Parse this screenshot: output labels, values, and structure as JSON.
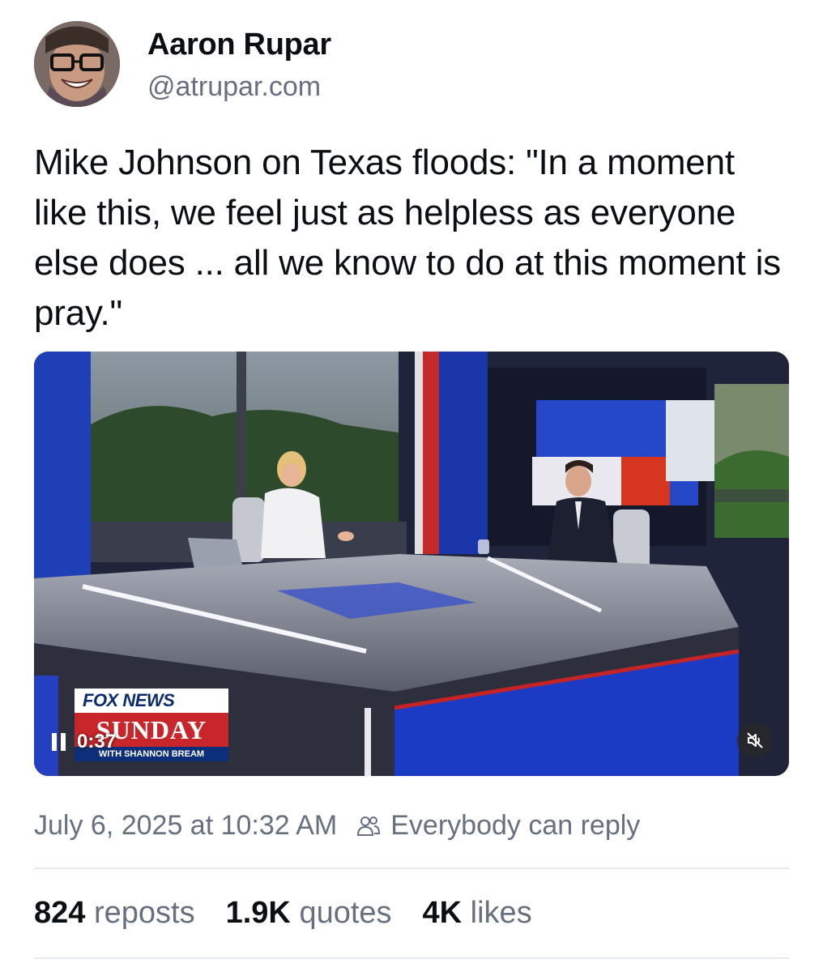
{
  "author": {
    "name": "Aaron Rupar",
    "handle": "@atrupar.com"
  },
  "post": {
    "text": "Mike Johnson on Texas floods: \"In a moment like this, we feel just as helpless as everyone else does ... all we know to do at this moment is pray.\""
  },
  "video": {
    "chyron_top": "FOX NEWS",
    "chyron_mid": "SUNDAY",
    "chyron_bottom": "WITH SHANNON BREAM",
    "time": "0:37",
    "icons": [
      "pause-icon",
      "muted-speaker-icon"
    ]
  },
  "meta": {
    "timestamp": "July 6, 2025 at 10:32 AM",
    "reply_setting": "Everybody can reply"
  },
  "stats": [
    {
      "count": "824",
      "label": "reposts"
    },
    {
      "count": "1.9K",
      "label": "quotes"
    },
    {
      "count": "4K",
      "label": "likes"
    }
  ],
  "colors": {
    "text": "#0b0f14",
    "muted": "#66707e",
    "fox_red": "#c9262b",
    "fox_blue": "#0d2f7a"
  }
}
